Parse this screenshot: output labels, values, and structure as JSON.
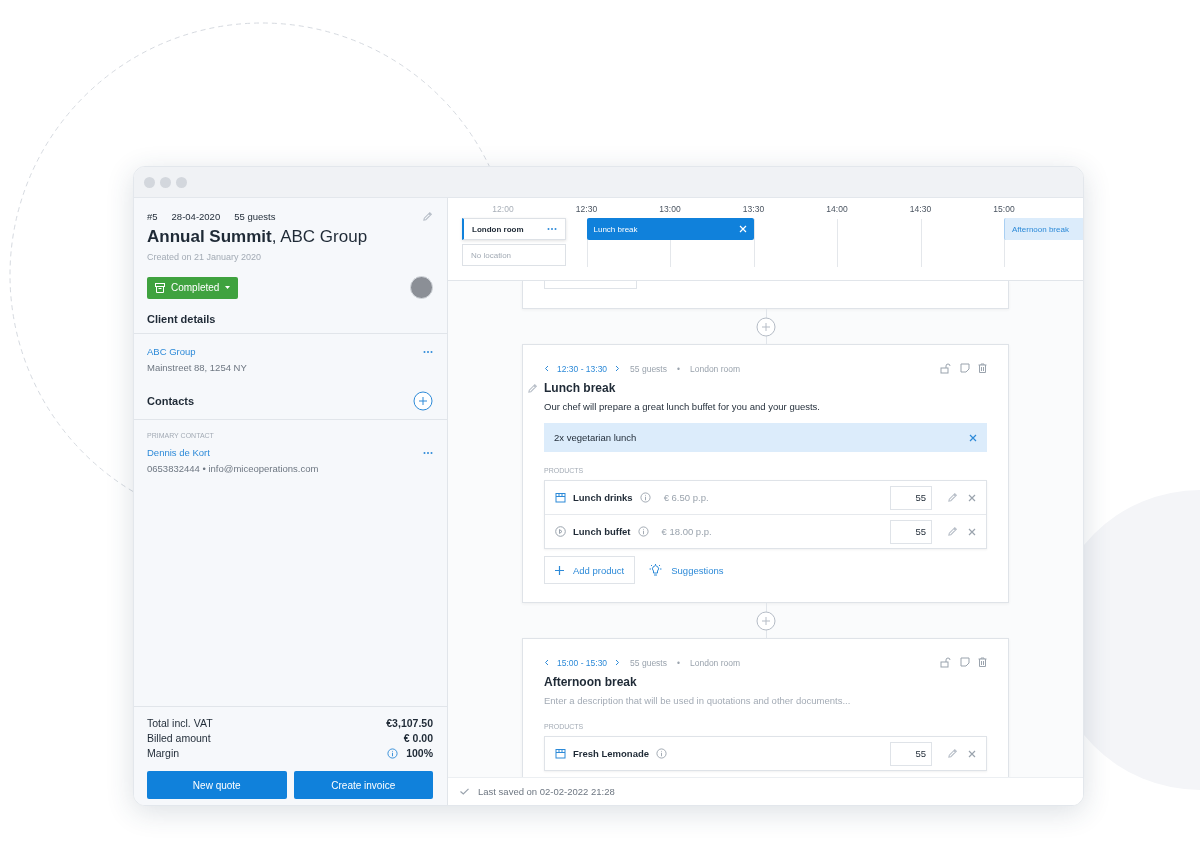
{
  "event": {
    "number": "#5",
    "date": "28-04-2020",
    "guests": "55 guests",
    "title": "**Annual Summit**, ABC Group",
    "created": "Created on 21 January 2020",
    "status": "Completed"
  },
  "client_details": {
    "heading": "Client details",
    "name": "ABC Group",
    "address": "Mainstreet 88, 1254 NY"
  },
  "contacts": {
    "heading": "Contacts",
    "label": "PRIMARY CONTACT",
    "name": "Dennis de Kort",
    "details": "0653832444 • info@miceoperations.com"
  },
  "totals": [
    {
      "label": "Total incl. VAT",
      "value": "€3,107.50",
      "info": false
    },
    {
      "label": "Billed amount",
      "value": "€ 0.00",
      "info": false
    },
    {
      "label": "Margin",
      "value": "100%",
      "info": true
    }
  ],
  "buttons": [
    "New quote",
    "Create invoice"
  ],
  "timeline": {
    "ticks": [
      {
        "label": "12:00",
        "muted": true
      },
      {
        "label": "12:30",
        "muted": false
      },
      {
        "label": "13:00",
        "muted": false
      },
      {
        "label": "13:30",
        "muted": false
      },
      {
        "label": "14:00",
        "muted": false
      },
      {
        "label": "14:30",
        "muted": false
      },
      {
        "label": "15:00",
        "muted": false
      }
    ],
    "rooms": [
      {
        "name": "London room",
        "selected": true
      },
      {
        "name": "No location",
        "selected": false
      }
    ],
    "events": [
      {
        "label": "Lunch break",
        "selected": true
      },
      {
        "label": "Afternoon break",
        "selected": false
      }
    ]
  },
  "agenda": [
    {
      "time": "12:30 - 13:30",
      "guests": "55 guests",
      "separator": "•",
      "room": "London room",
      "title": "Lunch break",
      "hovered": true,
      "description": {
        "value": "Our chef will prepare a great lunch buffet for you and your guests."
      },
      "note": "2x vegetarian lunch",
      "products_label": "PRODUCTS",
      "products": [
        {
          "kind": "drink",
          "name": "Lunch drinks",
          "price": "€ 6.50 p.p.",
          "quantity": "55"
        },
        {
          "kind": "food",
          "name": "Lunch buffet",
          "price": "€ 18.00 p.p.",
          "quantity": "55"
        }
      ],
      "add_product": "Add product",
      "suggestions": "Suggestions"
    },
    {
      "time": "15:00 - 15:30",
      "guests": "55 guests",
      "separator": "•",
      "room": "London room",
      "title": "Afternoon break",
      "hovered": false,
      "description": {
        "placeholder": "Enter a description that will be used in quotations and other documents..."
      },
      "products_label": "PRODUCTS",
      "products": [
        {
          "kind": "drink",
          "name": "Fresh Lemonade",
          "quantity": "55"
        }
      ]
    }
  ],
  "status_bar": {
    "text": "Last saved on 02-02-2022 21:28"
  }
}
